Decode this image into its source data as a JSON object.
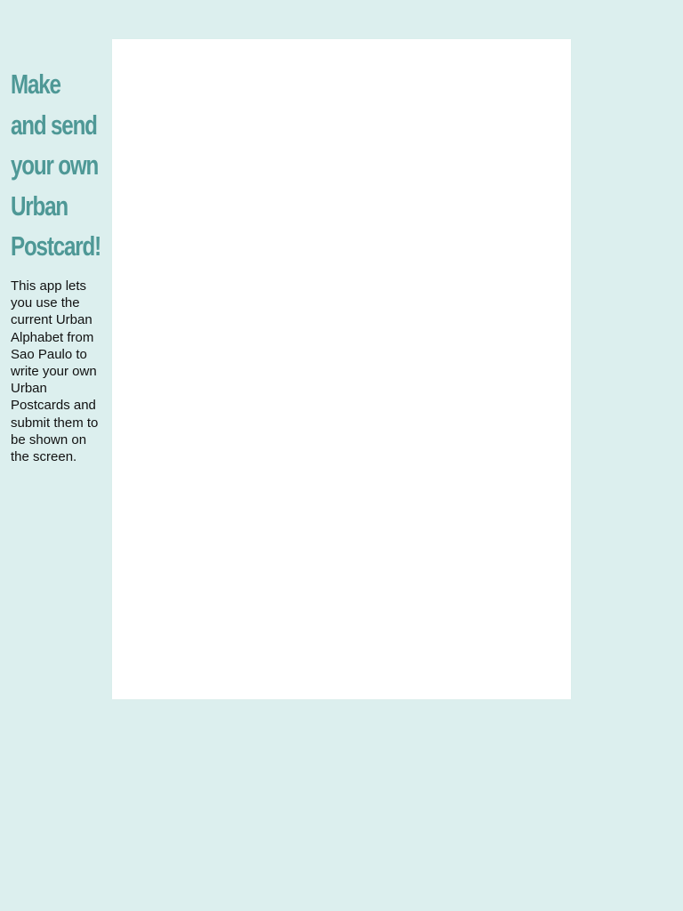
{
  "sidebar": {
    "heading_lines": [
      "Make",
      "and send",
      "your own",
      "Urban",
      "Postcard!"
    ],
    "description": "This app lets you use the current Urban Alphabet from Sao Paulo to write your own Urban Postcards and submit them to be shown on the screen."
  },
  "colors": {
    "background": "#dcefee",
    "heading": "#4e9896",
    "panel": "#ffffff",
    "body_text": "#111111"
  }
}
